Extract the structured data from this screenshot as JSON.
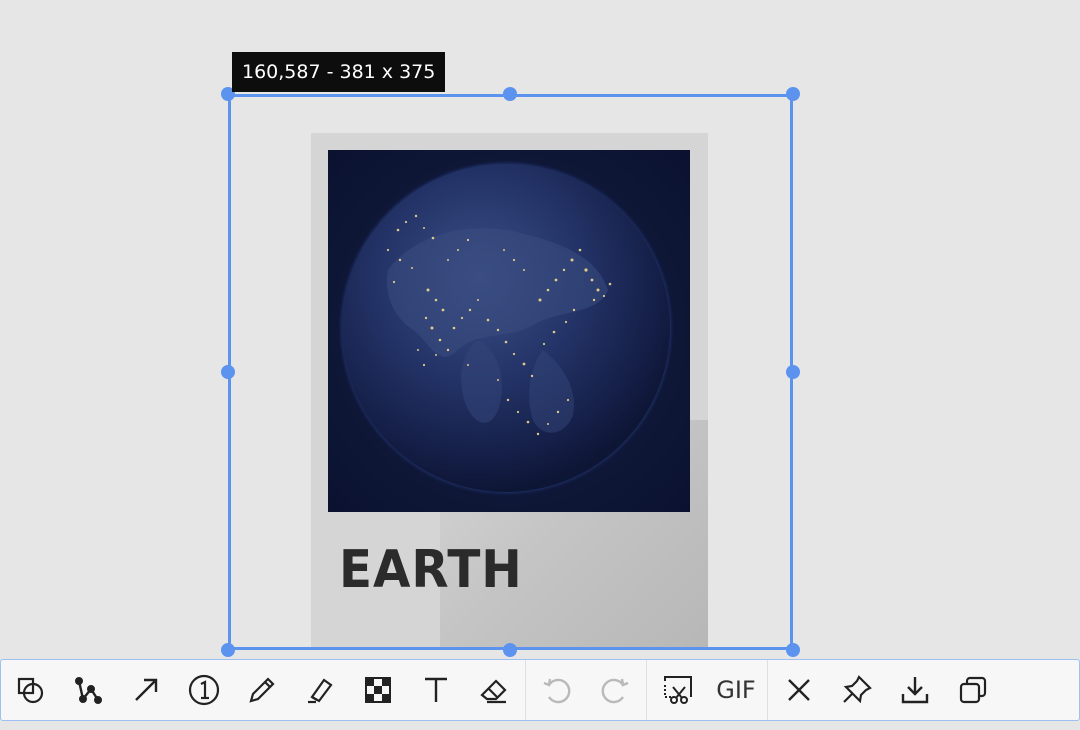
{
  "selection": {
    "readout": "160,587 - 381 x 375",
    "accent_color": "#5b93ee"
  },
  "poster": {
    "title": "EARTH",
    "image": "night-earth-globe"
  },
  "toolbar": {
    "gif_label": "GIF",
    "tools": [
      "shape-icon",
      "polyline-icon",
      "arrow-icon",
      "number-marker-icon",
      "pencil-icon",
      "highlighter-icon",
      "mosaic-icon",
      "text-icon",
      "eraser-icon",
      "undo-icon",
      "redo-icon",
      "capture-icon",
      "gif-icon",
      "close-icon",
      "pin-icon",
      "download-icon",
      "copy-icon"
    ]
  }
}
